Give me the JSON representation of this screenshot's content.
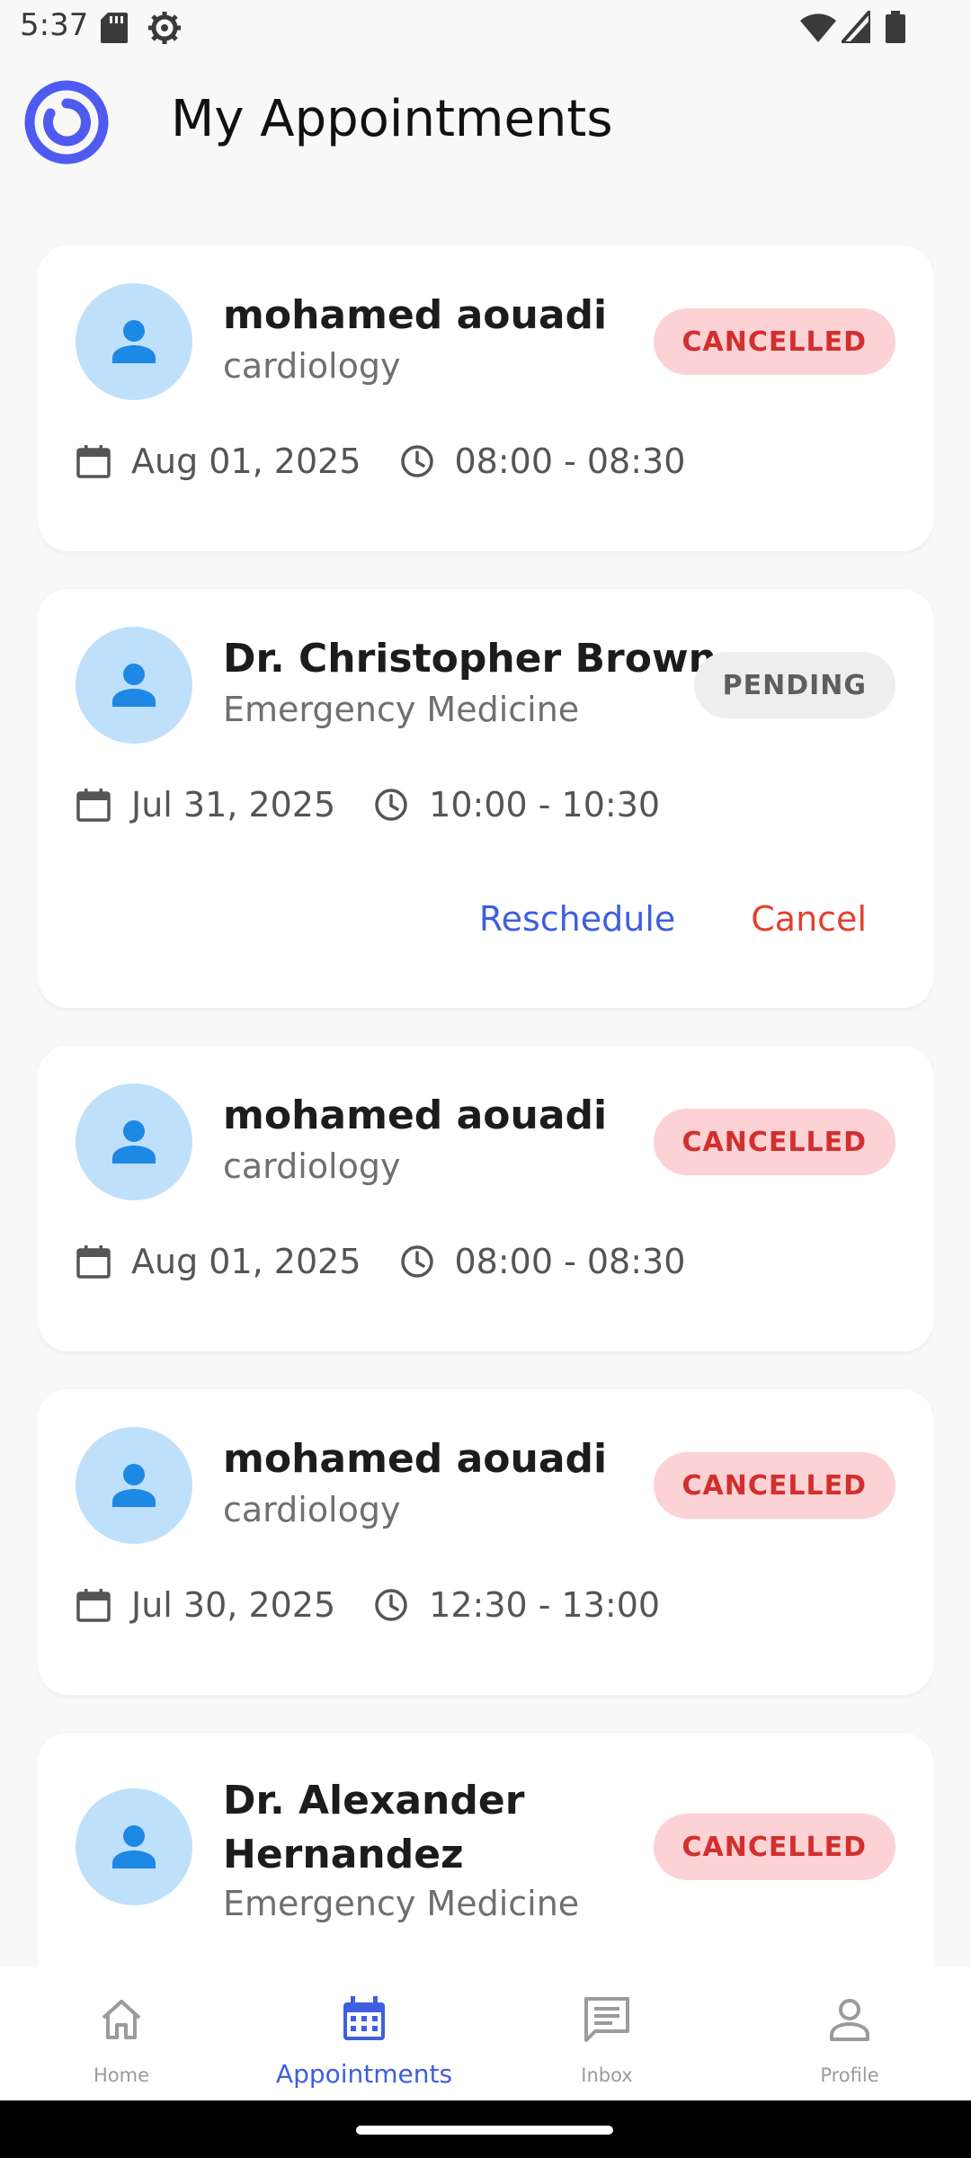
{
  "status_bar": {
    "time": "5:37"
  },
  "header": {
    "title": "My Appointments"
  },
  "colors": {
    "accent": "#3d5fe0",
    "cancelled_bg": "#fcd2d4",
    "cancelled_text": "#d32f2f",
    "pending_bg": "#eeeeee",
    "avatar_bg": "#bfe0fb",
    "avatar_icon": "#1e88e5"
  },
  "appointments": [
    {
      "name": "mohamed aouadi",
      "specialty": "cardiology",
      "status": "CANCELLED",
      "date": "Aug 01, 2025",
      "time": "08:00 - 08:30"
    },
    {
      "name": "Dr. Christopher Brown",
      "specialty": "Emergency Medicine",
      "status": "PENDING",
      "date": "Jul 31, 2025",
      "time": "10:00 - 10:30",
      "actions": {
        "reschedule": "Reschedule",
        "cancel": "Cancel"
      }
    },
    {
      "name": "mohamed aouadi",
      "specialty": "cardiology",
      "status": "CANCELLED",
      "date": "Aug 01, 2025",
      "time": "08:00 - 08:30"
    },
    {
      "name": "mohamed aouadi",
      "specialty": "cardiology",
      "status": "CANCELLED",
      "date": "Jul 30, 2025",
      "time": "12:30 - 13:00"
    },
    {
      "name": "Dr. Alexander Hernandez",
      "specialty": "Emergency Medicine",
      "status": "CANCELLED"
    }
  ],
  "nav": {
    "items": [
      {
        "label": "Home",
        "icon": "home-icon"
      },
      {
        "label": "Appointments",
        "icon": "calendar-icon",
        "active": true
      },
      {
        "label": "Inbox",
        "icon": "chat-icon"
      },
      {
        "label": "Profile",
        "icon": "person-icon"
      }
    ]
  }
}
